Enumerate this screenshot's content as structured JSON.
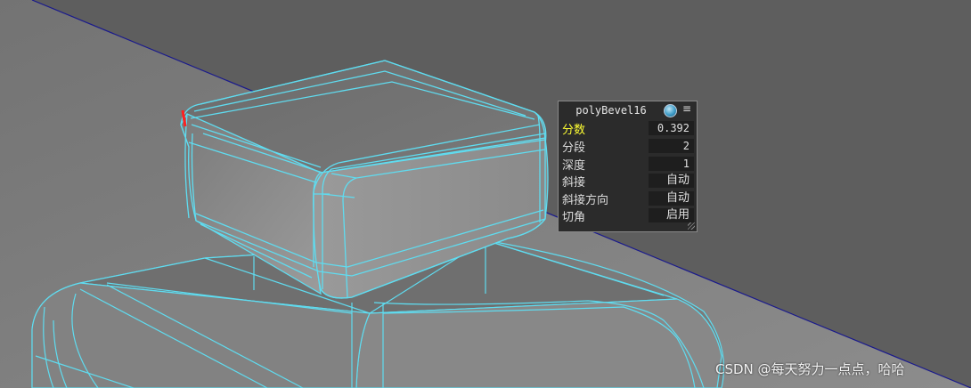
{
  "viewport": {
    "background_color": "#5e5e5e",
    "ground_color": "#808080",
    "wireframe_color": "#5fdcf0",
    "horizon_line_color": "#1a1a8c"
  },
  "poly_bevel_panel": {
    "title": "polyBevel16",
    "globe_icon": "globe-icon",
    "menu_icon": "≡",
    "rows": [
      {
        "label": "分数",
        "value": "0.392"
      },
      {
        "label": "分段",
        "value": "2"
      },
      {
        "label": "深度",
        "value": "1"
      },
      {
        "label": "斜接",
        "value": "自动"
      },
      {
        "label": "斜接方向",
        "value": "自动"
      },
      {
        "label": "切角",
        "value": "启用"
      }
    ],
    "active_label_color": "#ffff33"
  },
  "watermark": {
    "text": "CSDN @每天努力一点点，哈哈"
  }
}
